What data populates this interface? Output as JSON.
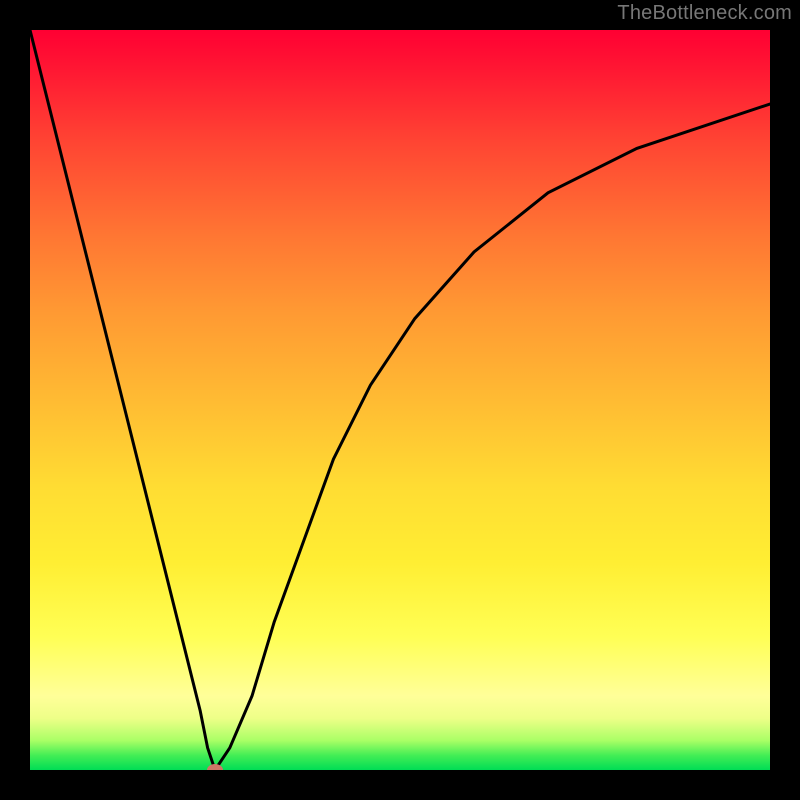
{
  "attribution": "TheBottleneck.com",
  "colors": {
    "frame": "#000000",
    "gradient_top": "#ff0033",
    "gradient_mid": "#ffee33",
    "gradient_bottom": "#00dd55",
    "curve": "#000000",
    "marker": "#cc7766"
  },
  "chart_data": {
    "type": "line",
    "title": "",
    "xlabel": "",
    "ylabel": "",
    "xlim": [
      0,
      100
    ],
    "ylim": [
      0,
      100
    ],
    "x": [
      0,
      2,
      5,
      8,
      11,
      14,
      17,
      20,
      22,
      23,
      24,
      25,
      27,
      30,
      33,
      37,
      41,
      46,
      52,
      60,
      70,
      82,
      100
    ],
    "values": [
      100,
      92,
      80,
      68,
      56,
      44,
      32,
      20,
      12,
      8,
      3,
      0,
      3,
      10,
      20,
      31,
      42,
      52,
      61,
      70,
      78,
      84,
      90
    ],
    "series": [
      {
        "name": "bottleneck-curve",
        "values": [
          100,
          92,
          80,
          68,
          56,
          44,
          32,
          20,
          12,
          8,
          3,
          0,
          3,
          10,
          20,
          31,
          42,
          52,
          61,
          70,
          78,
          84,
          90
        ]
      }
    ],
    "marker": {
      "x": 25,
      "y": 0
    },
    "grid": false,
    "legend_position": "none"
  }
}
